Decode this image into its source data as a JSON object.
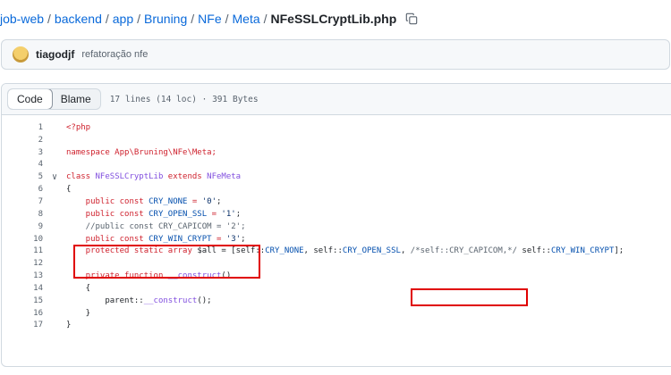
{
  "breadcrumb": {
    "parts": [
      "job-web",
      "backend",
      "app",
      "Bruning",
      "NFe",
      "Meta"
    ],
    "separator": "/",
    "current": "NFeSSLCryptLib.php"
  },
  "commit": {
    "author": "tiagodjf",
    "message": "refatoração nfe"
  },
  "file_header": {
    "code_tab": "Code",
    "blame_tab": "Blame",
    "info": "17 lines (14 loc) · 391 Bytes"
  },
  "code": {
    "line_numbers": [
      "1",
      "2",
      "3",
      "4",
      "5",
      "6",
      "7",
      "8",
      "9",
      "10",
      "11",
      "12",
      "13",
      "14",
      "15",
      "16",
      "17"
    ],
    "fold_marker": "∨",
    "lines": {
      "l1": {
        "a": "<?php"
      },
      "l3": {
        "a": "namespace App\\Bruning\\NFe\\Meta;"
      },
      "l5": {
        "a": "class ",
        "b": "NFeSSLCryptLib",
        "c": " extends ",
        "d": "NFeMeta"
      },
      "l6": {
        "a": "{"
      },
      "l7": {
        "a": "    public const ",
        "b": "CRY_NONE",
        "c": " = ",
        "d": "'0'",
        "e": ";"
      },
      "l8": {
        "a": "    public const ",
        "b": "CRY_OPEN_SSL",
        "c": " = ",
        "d": "'1'",
        "e": ";"
      },
      "l9": {
        "a": "    //public const CRY_CAPICOM = '2';"
      },
      "l10": {
        "a": "    public const ",
        "b": "CRY_WIN_CRYPT",
        "c": " = ",
        "d": "'3'",
        "e": ";"
      },
      "l11": {
        "a": "    protected static array ",
        "b": "$all",
        "c": " = [self::",
        "d": "CRY_NONE",
        "e": ", self::",
        "f": "CRY_OPEN_SSL",
        "g": ", ",
        "h": "/*self::CRY_CAPICOM,*/",
        "i": " self::",
        "j": "CRY_WIN_CRYPT",
        "k": "];"
      },
      "l13": {
        "a": "    private function ",
        "b": "__construct",
        "c": "()"
      },
      "l14": {
        "a": "    {"
      },
      "l15": {
        "a": "        parent::",
        "b": "__construct",
        "c": "();"
      },
      "l16": {
        "a": "    }"
      },
      "l17": {
        "a": "}"
      }
    }
  },
  "annotation_color": "#e00000"
}
